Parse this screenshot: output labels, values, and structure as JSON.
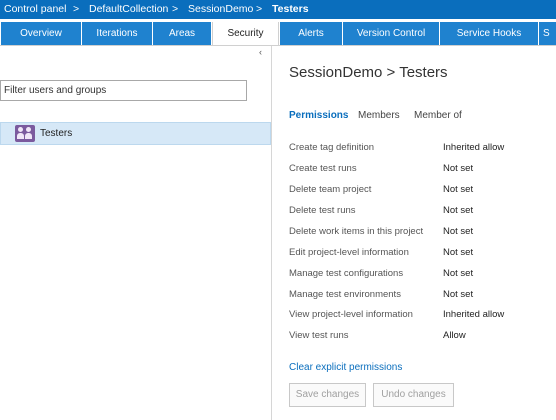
{
  "breadcrumb": {
    "items": [
      "Control panel",
      "DefaultCollection",
      "SessionDemo",
      "Testers"
    ],
    "separator": ">"
  },
  "tabs": [
    {
      "label": "Overview",
      "active": false
    },
    {
      "label": "Iterations",
      "active": false
    },
    {
      "label": "Areas",
      "active": false
    },
    {
      "label": "Security",
      "active": true
    },
    {
      "label": "Alerts",
      "active": false
    },
    {
      "label": "Version Control",
      "active": false
    },
    {
      "label": "Service Hooks",
      "active": false
    },
    {
      "label": "S",
      "active": false
    }
  ],
  "sidebar": {
    "collapse_glyph": "‹",
    "filter_placeholder": "Filter users and groups",
    "groups": [
      {
        "label": "Testers",
        "icon": "group-icon",
        "selected": true
      }
    ]
  },
  "main": {
    "title": "SessionDemo > Testers",
    "subtabs": [
      {
        "label": "Permissions",
        "active": true
      },
      {
        "label": "Members",
        "active": false
      },
      {
        "label": "Member of",
        "active": false
      }
    ],
    "permissions": [
      {
        "name": "Create tag definition",
        "value": "Inherited allow"
      },
      {
        "name": "Create test runs",
        "value": "Not set"
      },
      {
        "name": "Delete team project",
        "value": "Not set"
      },
      {
        "name": "Delete test runs",
        "value": "Not set"
      },
      {
        "name": "Delete work items in this project",
        "value": "Not set"
      },
      {
        "name": "Edit project-level information",
        "value": "Not set"
      },
      {
        "name": "Manage test configurations",
        "value": "Not set"
      },
      {
        "name": "Manage test environments",
        "value": "Not set"
      },
      {
        "name": "View project-level information",
        "value": "Inherited allow"
      },
      {
        "name": "View test runs",
        "value": "Allow"
      }
    ],
    "clear_link": "Clear explicit permissions",
    "save_label": "Save changes",
    "undo_label": "Undo changes"
  },
  "colors": {
    "topbar": "#0a6ebd",
    "tab": "#1f82cf",
    "selected_row": "#d6e8f7",
    "link": "#0a6ebd",
    "group_icon": "#7b5a9e"
  }
}
